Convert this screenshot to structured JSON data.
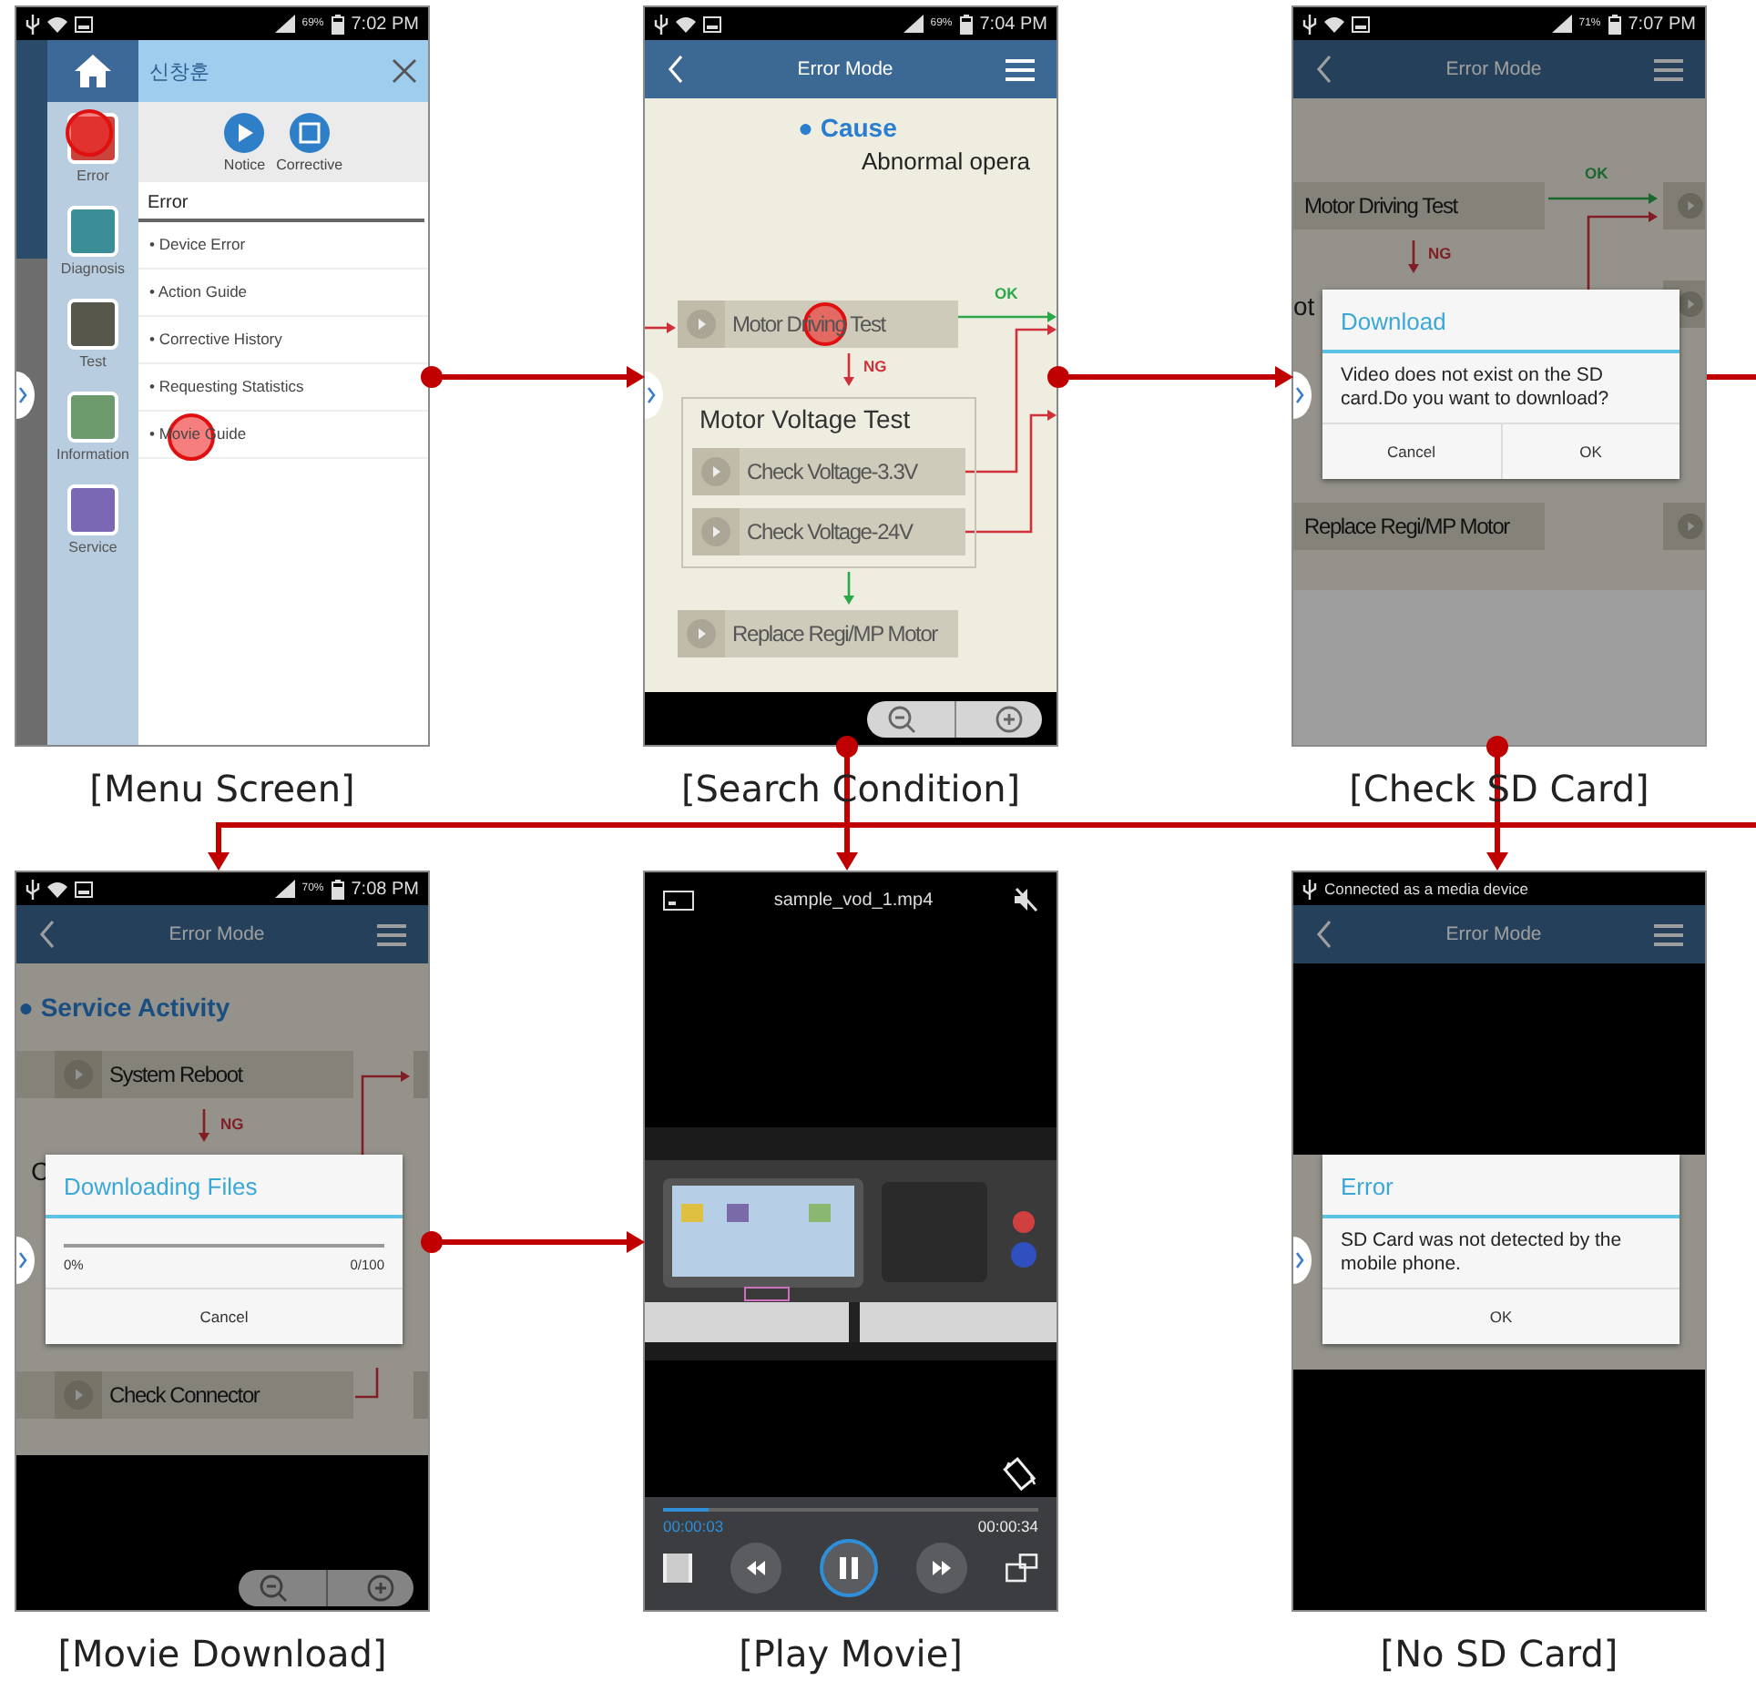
{
  "screens": [
    {
      "kind": "menu",
      "caption": "[Menu Screen]",
      "side_tab": true,
      "status": {
        "battery": "69%",
        "time": "7:02 PM"
      },
      "user": "신창훈",
      "sidebar": [
        {
          "label": "Error",
          "color": "#c8443c",
          "touched": true
        },
        {
          "label": "Diagnosis",
          "color": "#3b8e98",
          "touched": false
        },
        {
          "label": "Test",
          "color": "#56564a",
          "touched": false
        },
        {
          "label": "Information",
          "color": "#6d9a6c",
          "touched": false
        },
        {
          "label": "Service",
          "color": "#7a68b4",
          "touched": false
        }
      ],
      "shortcuts": [
        "Notice",
        "Corrective"
      ],
      "section": "Error",
      "items": [
        {
          "label": "• Device Error",
          "touched": false
        },
        {
          "label": "• Action Guide",
          "touched": false
        },
        {
          "label": "• Corrective History",
          "touched": false
        },
        {
          "label": "• Requesting Statistics",
          "touched": false
        },
        {
          "label": "• Movie Guide",
          "touched": true
        }
      ]
    },
    {
      "kind": "flow",
      "caption": "[Search Condition]",
      "side_tab": true,
      "status": {
        "battery": "69%",
        "time": "7:04 PM"
      },
      "header": "Error Mode",
      "cause": {
        "heading": "● Cause",
        "text": "Abnormal opera"
      },
      "first": {
        "label": "Motor Driving Test",
        "touched": true
      },
      "ok": "OK",
      "ng": "NG",
      "group": {
        "title": "Motor Voltage Test",
        "steps": [
          {
            "label": "Check Voltage-3.3V",
            "touched": false
          },
          {
            "label": "Check Voltage-24V",
            "touched": false
          }
        ]
      },
      "last": {
        "label": "Replace Regi/MP Motor",
        "touched": false
      }
    },
    {
      "kind": "confirm",
      "caption": "[Check SD Card]",
      "side_tab": true,
      "status": {
        "battery": "71%",
        "time": "7:07 PM"
      },
      "header": "Error Mode",
      "backdrop": {
        "first": "Motor Driving Test",
        "ok": "OK",
        "ng": "NG",
        "fragment": "ot",
        "last": "Replace Regi/MP Motor"
      },
      "dialog": {
        "title": "Download",
        "message": "Video does not exist on the SD card.Do you want to download?",
        "buttons": [
          "Cancel",
          "OK"
        ]
      }
    },
    {
      "kind": "download",
      "caption": "[Movie Download]",
      "side_tab": true,
      "status": {
        "battery": "70%",
        "time": "7:08 PM"
      },
      "header": "Error Mode",
      "backdrop": {
        "heading": "● Service Activity",
        "first": "System Reboot",
        "ng": "NG",
        "fragment": "C",
        "last": "Check Connector"
      },
      "dialog": {
        "title": "Downloading Files",
        "level": 0,
        "percent": "0%",
        "count": "0/100",
        "buttons": [
          "Cancel"
        ]
      }
    },
    {
      "kind": "video",
      "caption": "[Play Movie]",
      "file": "sample_vod_1.mp4",
      "level": 0.12,
      "elapsed": "00:00:03",
      "duration": "00:00:34",
      "playing": true
    },
    {
      "kind": "alert",
      "caption": "[No SD Card]",
      "side_tab": true,
      "status": {
        "notice": "Connected as a media device"
      },
      "header": "Error Mode",
      "dialog": {
        "title": "Error",
        "message": "SD Card was not detected by the mobile phone.",
        "buttons": [
          "OK"
        ]
      }
    }
  ]
}
